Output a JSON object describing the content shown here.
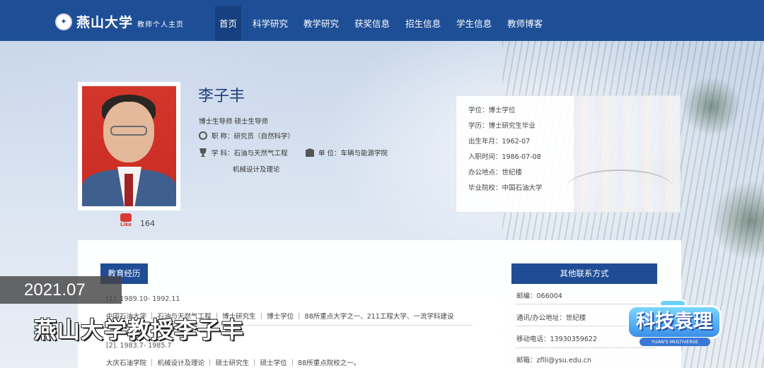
{
  "header": {
    "logo_name": "燕山大学",
    "logo_sub": "教师个人主页",
    "nav": [
      "首页",
      "科学研究",
      "教学研究",
      "获奖信息",
      "招生信息",
      "学生信息",
      "教师博客"
    ]
  },
  "profile": {
    "name": "李子丰",
    "roles": "博士生导师 硕士生导师",
    "title_label": "职 称：",
    "title_value": "研究员（自然科学）",
    "discipline_label": "学 科：",
    "discipline_value": "石油与天然气工程",
    "discipline_value2": "机械设计及理论",
    "unit_label": "单 位：",
    "unit_value": "车辆与能源学院",
    "like_word": "Like",
    "like_count": "164"
  },
  "info": [
    "学位：博士学位",
    "学历：博士研究生毕业",
    "出生年月：1962-07",
    "入职时间：1986-07-08",
    "办公地点：世纪楼",
    "毕业院校：中国石油大学"
  ],
  "education": {
    "heading": "教育经历",
    "items": [
      {
        "period": "[1]. 1989.10- 1992.11",
        "detail": "中国石油大学 ｜ 石油与天然气工程 ｜ 博士研究生 ｜ 博士学位 ｜ 88所重点大学之一、211工程大学、一流学科建设"
      },
      {
        "period": "[2]. 1983.7- 1985.7",
        "detail": "大庆石油学院 ｜ 机械设计及理论 ｜ 硕士研究生 ｜ 硕士学位 ｜ 88所重点院校之一。"
      }
    ]
  },
  "contact": {
    "heading": "其他联系方式",
    "items": [
      "邮编：066004",
      "通讯/办公地址：世纪楼",
      "移动电话：13930359622",
      "邮箱：zflli@ysu.edu.cn"
    ]
  },
  "overlay": {
    "date": "2021.07",
    "title": "燕山大学教授李子丰",
    "badge_main": "科技袁理",
    "badge_sub": "YUAN'S MULTIVERSE"
  }
}
